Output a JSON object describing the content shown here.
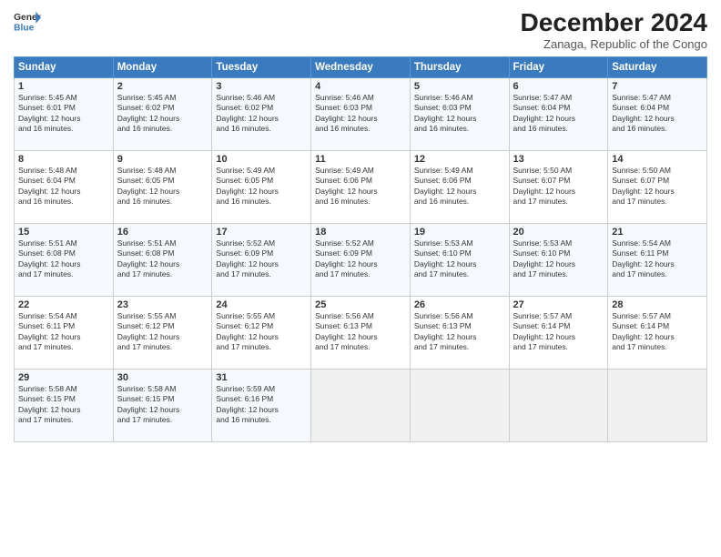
{
  "header": {
    "logo_line1": "General",
    "logo_line2": "Blue",
    "month": "December 2024",
    "location": "Zanaga, Republic of the Congo"
  },
  "days_of_week": [
    "Sunday",
    "Monday",
    "Tuesday",
    "Wednesday",
    "Thursday",
    "Friday",
    "Saturday"
  ],
  "weeks": [
    [
      {
        "day": "1",
        "lines": [
          "Sunrise: 5:45 AM",
          "Sunset: 6:01 PM",
          "Daylight: 12 hours",
          "and 16 minutes."
        ]
      },
      {
        "day": "2",
        "lines": [
          "Sunrise: 5:45 AM",
          "Sunset: 6:02 PM",
          "Daylight: 12 hours",
          "and 16 minutes."
        ]
      },
      {
        "day": "3",
        "lines": [
          "Sunrise: 5:46 AM",
          "Sunset: 6:02 PM",
          "Daylight: 12 hours",
          "and 16 minutes."
        ]
      },
      {
        "day": "4",
        "lines": [
          "Sunrise: 5:46 AM",
          "Sunset: 6:03 PM",
          "Daylight: 12 hours",
          "and 16 minutes."
        ]
      },
      {
        "day": "5",
        "lines": [
          "Sunrise: 5:46 AM",
          "Sunset: 6:03 PM",
          "Daylight: 12 hours",
          "and 16 minutes."
        ]
      },
      {
        "day": "6",
        "lines": [
          "Sunrise: 5:47 AM",
          "Sunset: 6:04 PM",
          "Daylight: 12 hours",
          "and 16 minutes."
        ]
      },
      {
        "day": "7",
        "lines": [
          "Sunrise: 5:47 AM",
          "Sunset: 6:04 PM",
          "Daylight: 12 hours",
          "and 16 minutes."
        ]
      }
    ],
    [
      {
        "day": "8",
        "lines": [
          "Sunrise: 5:48 AM",
          "Sunset: 6:04 PM",
          "Daylight: 12 hours",
          "and 16 minutes."
        ]
      },
      {
        "day": "9",
        "lines": [
          "Sunrise: 5:48 AM",
          "Sunset: 6:05 PM",
          "Daylight: 12 hours",
          "and 16 minutes."
        ]
      },
      {
        "day": "10",
        "lines": [
          "Sunrise: 5:49 AM",
          "Sunset: 6:05 PM",
          "Daylight: 12 hours",
          "and 16 minutes."
        ]
      },
      {
        "day": "11",
        "lines": [
          "Sunrise: 5:49 AM",
          "Sunset: 6:06 PM",
          "Daylight: 12 hours",
          "and 16 minutes."
        ]
      },
      {
        "day": "12",
        "lines": [
          "Sunrise: 5:49 AM",
          "Sunset: 6:06 PM",
          "Daylight: 12 hours",
          "and 16 minutes."
        ]
      },
      {
        "day": "13",
        "lines": [
          "Sunrise: 5:50 AM",
          "Sunset: 6:07 PM",
          "Daylight: 12 hours",
          "and 17 minutes."
        ]
      },
      {
        "day": "14",
        "lines": [
          "Sunrise: 5:50 AM",
          "Sunset: 6:07 PM",
          "Daylight: 12 hours",
          "and 17 minutes."
        ]
      }
    ],
    [
      {
        "day": "15",
        "lines": [
          "Sunrise: 5:51 AM",
          "Sunset: 6:08 PM",
          "Daylight: 12 hours",
          "and 17 minutes."
        ]
      },
      {
        "day": "16",
        "lines": [
          "Sunrise: 5:51 AM",
          "Sunset: 6:08 PM",
          "Daylight: 12 hours",
          "and 17 minutes."
        ]
      },
      {
        "day": "17",
        "lines": [
          "Sunrise: 5:52 AM",
          "Sunset: 6:09 PM",
          "Daylight: 12 hours",
          "and 17 minutes."
        ]
      },
      {
        "day": "18",
        "lines": [
          "Sunrise: 5:52 AM",
          "Sunset: 6:09 PM",
          "Daylight: 12 hours",
          "and 17 minutes."
        ]
      },
      {
        "day": "19",
        "lines": [
          "Sunrise: 5:53 AM",
          "Sunset: 6:10 PM",
          "Daylight: 12 hours",
          "and 17 minutes."
        ]
      },
      {
        "day": "20",
        "lines": [
          "Sunrise: 5:53 AM",
          "Sunset: 6:10 PM",
          "Daylight: 12 hours",
          "and 17 minutes."
        ]
      },
      {
        "day": "21",
        "lines": [
          "Sunrise: 5:54 AM",
          "Sunset: 6:11 PM",
          "Daylight: 12 hours",
          "and 17 minutes."
        ]
      }
    ],
    [
      {
        "day": "22",
        "lines": [
          "Sunrise: 5:54 AM",
          "Sunset: 6:11 PM",
          "Daylight: 12 hours",
          "and 17 minutes."
        ]
      },
      {
        "day": "23",
        "lines": [
          "Sunrise: 5:55 AM",
          "Sunset: 6:12 PM",
          "Daylight: 12 hours",
          "and 17 minutes."
        ]
      },
      {
        "day": "24",
        "lines": [
          "Sunrise: 5:55 AM",
          "Sunset: 6:12 PM",
          "Daylight: 12 hours",
          "and 17 minutes."
        ]
      },
      {
        "day": "25",
        "lines": [
          "Sunrise: 5:56 AM",
          "Sunset: 6:13 PM",
          "Daylight: 12 hours",
          "and 17 minutes."
        ]
      },
      {
        "day": "26",
        "lines": [
          "Sunrise: 5:56 AM",
          "Sunset: 6:13 PM",
          "Daylight: 12 hours",
          "and 17 minutes."
        ]
      },
      {
        "day": "27",
        "lines": [
          "Sunrise: 5:57 AM",
          "Sunset: 6:14 PM",
          "Daylight: 12 hours",
          "and 17 minutes."
        ]
      },
      {
        "day": "28",
        "lines": [
          "Sunrise: 5:57 AM",
          "Sunset: 6:14 PM",
          "Daylight: 12 hours",
          "and 17 minutes."
        ]
      }
    ],
    [
      {
        "day": "29",
        "lines": [
          "Sunrise: 5:58 AM",
          "Sunset: 6:15 PM",
          "Daylight: 12 hours",
          "and 17 minutes."
        ]
      },
      {
        "day": "30",
        "lines": [
          "Sunrise: 5:58 AM",
          "Sunset: 6:15 PM",
          "Daylight: 12 hours",
          "and 17 minutes."
        ]
      },
      {
        "day": "31",
        "lines": [
          "Sunrise: 5:59 AM",
          "Sunset: 6:16 PM",
          "Daylight: 12 hours",
          "and 16 minutes."
        ]
      },
      {
        "day": "",
        "lines": []
      },
      {
        "day": "",
        "lines": []
      },
      {
        "day": "",
        "lines": []
      },
      {
        "day": "",
        "lines": []
      }
    ]
  ]
}
